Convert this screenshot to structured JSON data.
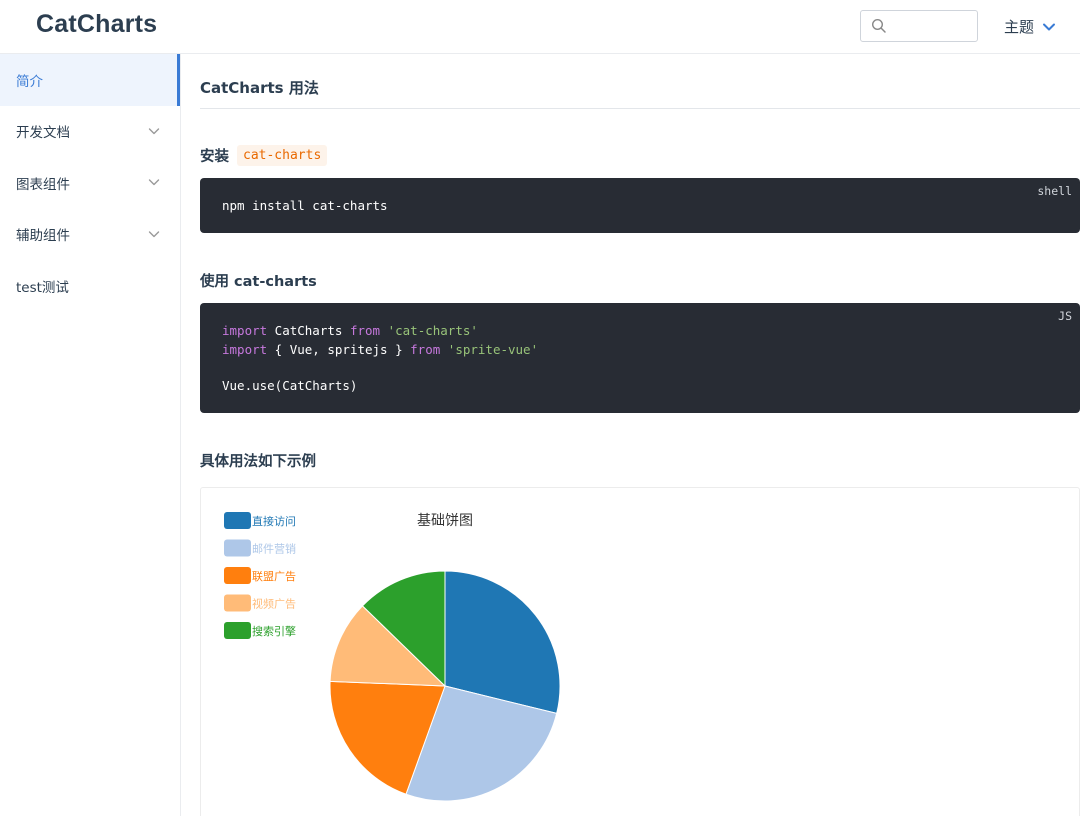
{
  "header": {
    "logo": "CatCharts",
    "search": {
      "placeholder": "",
      "value": ""
    },
    "theme_label": "主题"
  },
  "sidebar": {
    "items": [
      {
        "label": "简介",
        "active": true,
        "expandable": false
      },
      {
        "label": "开发文档",
        "active": false,
        "expandable": true
      },
      {
        "label": "图表组件",
        "active": false,
        "expandable": true
      },
      {
        "label": "辅助组件",
        "active": false,
        "expandable": true
      },
      {
        "label": "test测试",
        "active": false,
        "expandable": false
      }
    ]
  },
  "main": {
    "title": "CatCharts 用法",
    "install": {
      "heading": "安装",
      "code_tag": "cat-charts",
      "lang": "shell",
      "command": "npm install cat-charts"
    },
    "usage": {
      "heading": "使用 cat-charts",
      "lang": "JS",
      "lines": [
        {
          "kw": "import",
          "mid": " CatCharts ",
          "kw2": "from",
          "str": " 'cat-charts'"
        },
        {
          "kw": "import",
          "mid": " { Vue, spritejs } ",
          "kw2": "from",
          "str": " 'sprite-vue'"
        }
      ],
      "last_line": "Vue.use(CatCharts)"
    },
    "example_heading": "具体用法如下示例"
  },
  "colors": {
    "accent": "#3a7bd5",
    "code_bg": "#282c34",
    "inline_code": "#e96900"
  },
  "chart_data": {
    "type": "pie",
    "title": "基础饼图",
    "legend_position": "top-left",
    "categories": [
      "直接访问",
      "邮件营销",
      "联盟广告",
      "视频广告",
      "搜索引擎"
    ],
    "values": [
      335,
      310,
      234,
      135,
      148
    ],
    "colors": [
      "#1f77b4",
      "#aec7e8",
      "#ff7f0e",
      "#ffbb78",
      "#2ca02c"
    ],
    "start_angle_deg": 90,
    "direction": "clockwise"
  }
}
